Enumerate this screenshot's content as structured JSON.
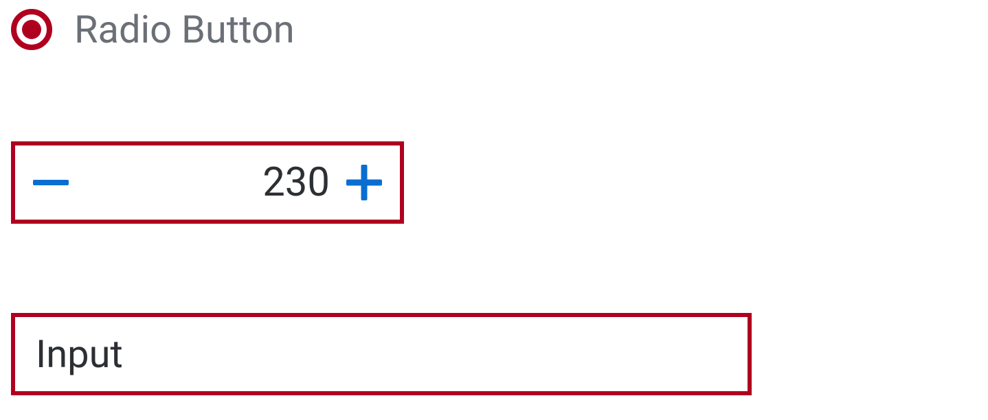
{
  "radio": {
    "label": "Radio Button",
    "selected": true
  },
  "stepper": {
    "value": "230"
  },
  "input": {
    "placeholder": "Input",
    "value": ""
  },
  "colors": {
    "error_border": "#b00020",
    "icon_primary": "#0a6ed1",
    "text_muted": "#6b6f76",
    "text": "#2c2f33"
  }
}
